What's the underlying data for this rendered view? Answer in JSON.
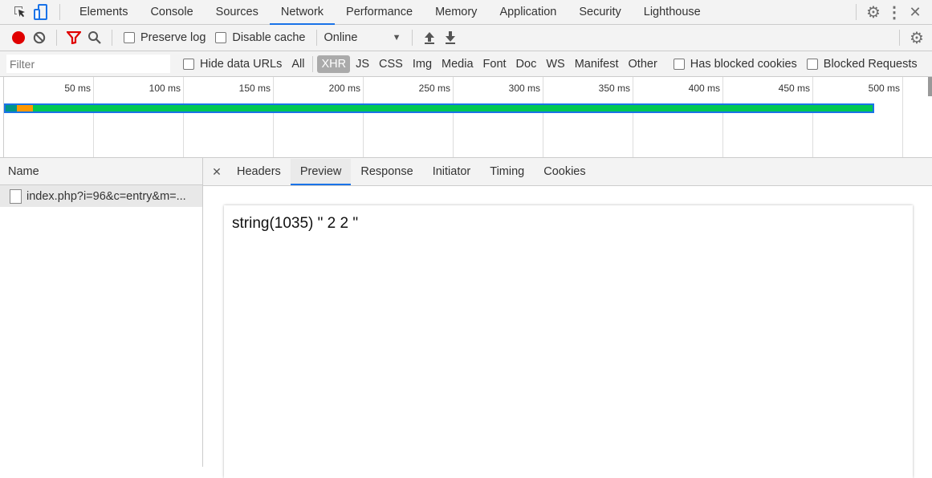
{
  "toolbar": {
    "tabs": [
      "Elements",
      "Console",
      "Sources",
      "Network",
      "Performance",
      "Memory",
      "Application",
      "Security",
      "Lighthouse"
    ],
    "active_tab": "Network"
  },
  "network_toolbar": {
    "preserve_log": "Preserve log",
    "disable_cache": "Disable cache",
    "throttling": "Online"
  },
  "filter_bar": {
    "placeholder": "Filter",
    "hide_data_urls": "Hide data URLs",
    "types": [
      "All",
      "XHR",
      "JS",
      "CSS",
      "Img",
      "Media",
      "Font",
      "Doc",
      "WS",
      "Manifest",
      "Other"
    ],
    "active_type": "XHR",
    "has_blocked_cookies": "Has blocked cookies",
    "blocked_requests": "Blocked Requests"
  },
  "timeline": {
    "ticks": [
      "50 ms",
      "100 ms",
      "150 ms",
      "200 ms",
      "250 ms",
      "300 ms",
      "350 ms",
      "400 ms",
      "450 ms",
      "500 ms"
    ],
    "colors": {
      "waiting": "#009688",
      "queue": "#ff9800",
      "download": "#00c853",
      "outline": "#1a73e8"
    }
  },
  "requests": {
    "header": "Name",
    "items": [
      {
        "name": "index.php?i=96&c=entry&m=..."
      }
    ]
  },
  "details": {
    "tabs": [
      "Headers",
      "Preview",
      "Response",
      "Initiator",
      "Timing",
      "Cookies"
    ],
    "active": "Preview",
    "preview_text": "string(1035) \" 2 2 \""
  },
  "colors": {
    "accent": "#1a73e8",
    "record": "#e00000",
    "filter": "#e00000"
  }
}
